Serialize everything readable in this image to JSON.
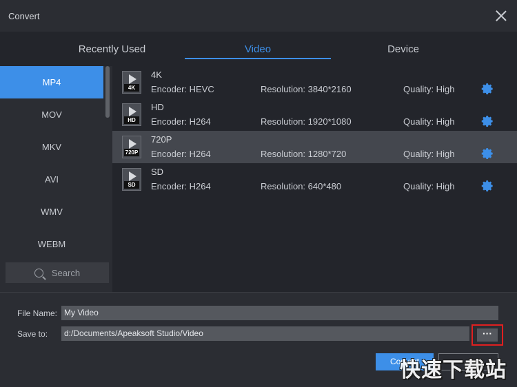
{
  "window": {
    "title": "Convert"
  },
  "tabs": [
    {
      "label": "Recently Used"
    },
    {
      "label": "Video"
    },
    {
      "label": "Device"
    }
  ],
  "sidebar": {
    "items": [
      {
        "label": "MP4"
      },
      {
        "label": "MOV"
      },
      {
        "label": "MKV"
      },
      {
        "label": "AVI"
      },
      {
        "label": "WMV"
      },
      {
        "label": "WEBM"
      }
    ],
    "search_label": "Search"
  },
  "presets": [
    {
      "name": "4K",
      "tag": "4K",
      "encoder": "Encoder: HEVC",
      "resolution": "Resolution: 3840*2160",
      "quality": "Quality: High"
    },
    {
      "name": "HD",
      "tag": "HD",
      "encoder": "Encoder: H264",
      "resolution": "Resolution: 1920*1080",
      "quality": "Quality: High"
    },
    {
      "name": "720P",
      "tag": "720P",
      "encoder": "Encoder: H264",
      "resolution": "Resolution: 1280*720",
      "quality": "Quality: High"
    },
    {
      "name": "SD",
      "tag": "SD",
      "encoder": "Encoder: H264",
      "resolution": "Resolution: 640*480",
      "quality": "Quality: High"
    }
  ],
  "form": {
    "file_name_label": "File Name:",
    "file_name_value": "My Video",
    "save_to_label": "Save to:",
    "save_to_value": "d:/Documents/Apeaksoft Studio/Video",
    "browse_label": "···"
  },
  "buttons": {
    "convert": "Convert",
    "cancel": ""
  },
  "watermark": "快速下载站",
  "colors": {
    "accent": "#3d8fe8",
    "highlight_box": "#e02020"
  }
}
